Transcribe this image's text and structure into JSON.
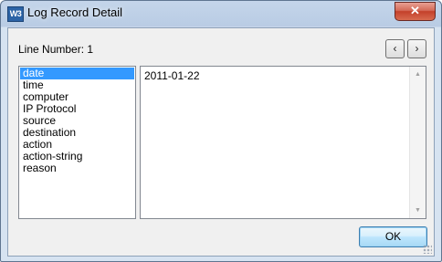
{
  "window": {
    "icon_text": "W3",
    "title": "Log Record Detail",
    "close_glyph": "✕"
  },
  "header": {
    "line_number": "Line Number: 1",
    "prev_glyph": "‹",
    "next_glyph": "›"
  },
  "fields": {
    "items": [
      {
        "label": "date",
        "selected": true
      },
      {
        "label": "time"
      },
      {
        "label": "computer"
      },
      {
        "label": "IP Protocol"
      },
      {
        "label": "source"
      },
      {
        "label": "destination"
      },
      {
        "label": "action"
      },
      {
        "label": "action-string"
      },
      {
        "label": "reason"
      }
    ]
  },
  "detail": {
    "value": "2011-01-22",
    "scroll_up_glyph": "▲",
    "scroll_down_glyph": "▼"
  },
  "footer": {
    "ok_label": "OK"
  },
  "icons": [
    "app-icon",
    "close-icon",
    "chevron-left-icon",
    "chevron-right-icon",
    "scroll-up-icon",
    "scroll-down-icon",
    "resize-grip-icon"
  ],
  "colors": {
    "selection": "#3399ff",
    "titlebar": "#b9cce4",
    "close_button": "#c3402a"
  }
}
